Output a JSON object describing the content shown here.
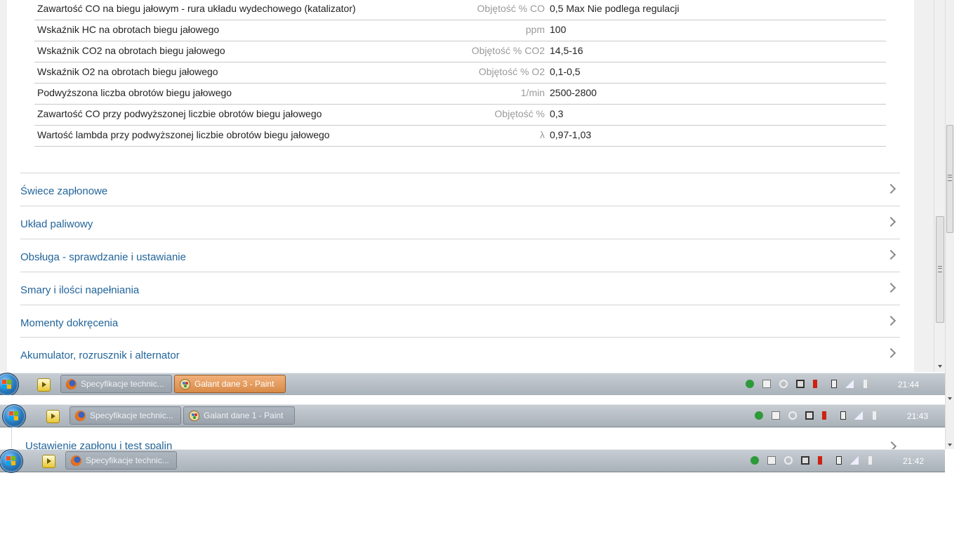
{
  "spec_rows": [
    {
      "name": "Zawartość CO na biegu jałowym - rura układu wydechowego (katalizator)",
      "unit": "Objętość % CO",
      "value": "0,5 Max Nie podlega regulacji"
    },
    {
      "name": "Wskaźnik HC na obrotach biegu jałowego",
      "unit": "ppm",
      "value": "100"
    },
    {
      "name": "Wskaźnik CO2 na obrotach biegu jałowego",
      "unit": "Objętość % CO2",
      "value": "14,5-16"
    },
    {
      "name": "Wskaźnik O2 na obrotach biegu jałowego",
      "unit": "Objętość % O2",
      "value": "0,1-0,5"
    },
    {
      "name": "Podwyższona liczba obrotów biegu jałowego",
      "unit": "1/min",
      "value": "2500-2800"
    },
    {
      "name": "Zawartość CO przy podwyższonej liczbie obrotów biegu jałowego",
      "unit": "Objętość %",
      "value": "0,3"
    },
    {
      "name": "Wartość lambda przy podwyższonej liczbie obrotów biegu jałowego",
      "unit": "λ",
      "value": "0,97-1,03"
    }
  ],
  "sections": [
    {
      "label": "Świece zapłonowe"
    },
    {
      "label": "Układ paliwowy"
    },
    {
      "label": "Obsługa - sprawdzanie i ustawianie"
    },
    {
      "label": "Smary i ilości napełniania"
    },
    {
      "label": "Momenty dokręcenia"
    },
    {
      "label": "Akumulator, rozrusznik i alternator"
    }
  ],
  "peek_section": {
    "label": "Ustawienie zapłonu i test spalin"
  },
  "taskbars": [
    {
      "tasks": [
        {
          "label": "Specyfikacje technic...",
          "icon": "firefox-icon"
        },
        {
          "label": "Galant dane 3 - Paint",
          "icon": "paint-icon",
          "active": true
        }
      ],
      "clock": "21:44"
    },
    {
      "tasks": [
        {
          "label": "Specyfikacje technic...",
          "icon": "firefox-icon"
        },
        {
          "label": "Galant dane 1 - Paint",
          "icon": "paint-icon"
        }
      ],
      "clock": "21:43"
    },
    {
      "tasks": [
        {
          "label": "Specyfikacje technic...",
          "icon": "firefox-icon"
        }
      ],
      "clock": "21:42"
    }
  ],
  "tray_icons": [
    "shield-check-icon",
    "flag-x-icon",
    "network-globe-icon",
    "monitor-icon",
    "volume-icon",
    "battery-icon",
    "signal-bars-icon",
    "speaker-muted-icon"
  ],
  "colors": {
    "link": "#23659a",
    "unit_gray": "#9a9a9a",
    "taskbar": "#a9b1b9",
    "active_task": "#d98b48"
  }
}
